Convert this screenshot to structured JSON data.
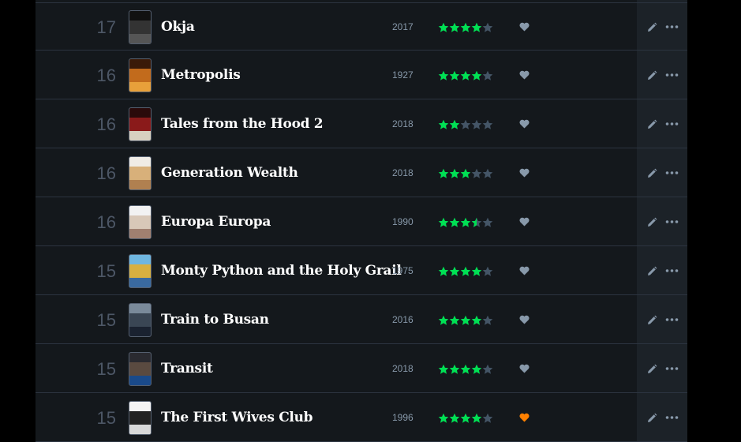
{
  "colors": {
    "star_filled": "#00e054",
    "star_empty": "#445566",
    "heart_default": "#8899aa",
    "heart_liked": "#ff8000"
  },
  "entries": [
    {
      "day": "17",
      "title": "Okja",
      "year": "2017",
      "rating": 4,
      "liked": false,
      "poster_colors": [
        "#111111",
        "#333333",
        "#555555"
      ]
    },
    {
      "day": "16",
      "title": "Metropolis",
      "year": "1927",
      "rating": 4,
      "liked": false,
      "poster_colors": [
        "#3a1a08",
        "#c26b1c",
        "#e8a03a"
      ]
    },
    {
      "day": "16",
      "title": "Tales from the Hood 2",
      "year": "2018",
      "rating": 2,
      "liked": false,
      "poster_colors": [
        "#2a0a0a",
        "#8a1a1a",
        "#d8d0c0"
      ]
    },
    {
      "day": "16",
      "title": "Generation Wealth",
      "year": "2018",
      "rating": 3,
      "liked": false,
      "poster_colors": [
        "#f0ece6",
        "#d8b07a",
        "#b08050"
      ]
    },
    {
      "day": "16",
      "title": "Europa Europa",
      "year": "1990",
      "rating": 3.5,
      "liked": false,
      "poster_colors": [
        "#f2f2f2",
        "#d8c8b8",
        "#a08070"
      ]
    },
    {
      "day": "15",
      "title": "Monty Python and the Holy Grail",
      "year": "1975",
      "rating": 4,
      "liked": false,
      "poster_colors": [
        "#6fb6e0",
        "#d8b040",
        "#3a6aa0"
      ]
    },
    {
      "day": "15",
      "title": "Train to Busan",
      "year": "2016",
      "rating": 4,
      "liked": false,
      "poster_colors": [
        "#7a8a9a",
        "#3a4654",
        "#1a2230"
      ]
    },
    {
      "day": "15",
      "title": "Transit",
      "year": "2018",
      "rating": 4,
      "liked": false,
      "poster_colors": [
        "#2a2a30",
        "#5a4a40",
        "#1a4a8a"
      ]
    },
    {
      "day": "15",
      "title": "The First Wives Club",
      "year": "1996",
      "rating": 4,
      "liked": true,
      "poster_colors": [
        "#f4f4f4",
        "#222222",
        "#d8d8d8"
      ]
    }
  ]
}
